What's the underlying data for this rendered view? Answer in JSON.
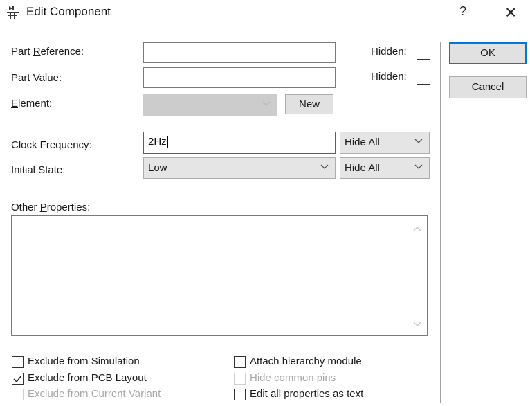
{
  "window": {
    "title": "Edit Component",
    "title_icon": "component-icon",
    "help_glyph": "?",
    "close_glyph": "×"
  },
  "fields": {
    "part_reference": {
      "label_prefix": "Part ",
      "label_accel": "R",
      "label_rest": "eference:",
      "value": "",
      "hidden_label": "Hidden:"
    },
    "part_value": {
      "label_prefix": "Part ",
      "label_accel": "V",
      "label_rest": "alue:",
      "value": "",
      "hidden_label": "Hidden:"
    },
    "element": {
      "label_accel": "E",
      "label_rest": "lement:",
      "value": "",
      "new_button": "New"
    },
    "clock_frequency": {
      "label": "Clock Frequency:",
      "value": "2Hz",
      "visibility": "Hide All"
    },
    "initial_state": {
      "label": "Initial State:",
      "value": "Low",
      "visibility": "Hide All"
    },
    "other_properties": {
      "label_prefix": "Other ",
      "label_accel": "P",
      "label_rest": "roperties:",
      "value": ""
    }
  },
  "buttons": {
    "ok": "OK",
    "cancel": "Cancel"
  },
  "options": {
    "exclude_simulation": {
      "label": "Exclude from Simulation",
      "checked": false
    },
    "exclude_pcb": {
      "label": "Exclude from PCB Layout",
      "checked": true
    },
    "exclude_variant": {
      "label": "Exclude from Current Variant",
      "checked": false,
      "disabled": true
    },
    "attach_hierarchy": {
      "label": "Attach hierarchy module",
      "checked": false
    },
    "hide_common_pins": {
      "label": "Hide common pins",
      "checked": false,
      "disabled": true
    },
    "edit_as_text": {
      "label": "Edit all properties as text",
      "checked": false
    }
  },
  "colors": {
    "accent": "#0078d7",
    "disabled_text": "#a8a8a8",
    "combo_bg": "#e5e5e5"
  }
}
